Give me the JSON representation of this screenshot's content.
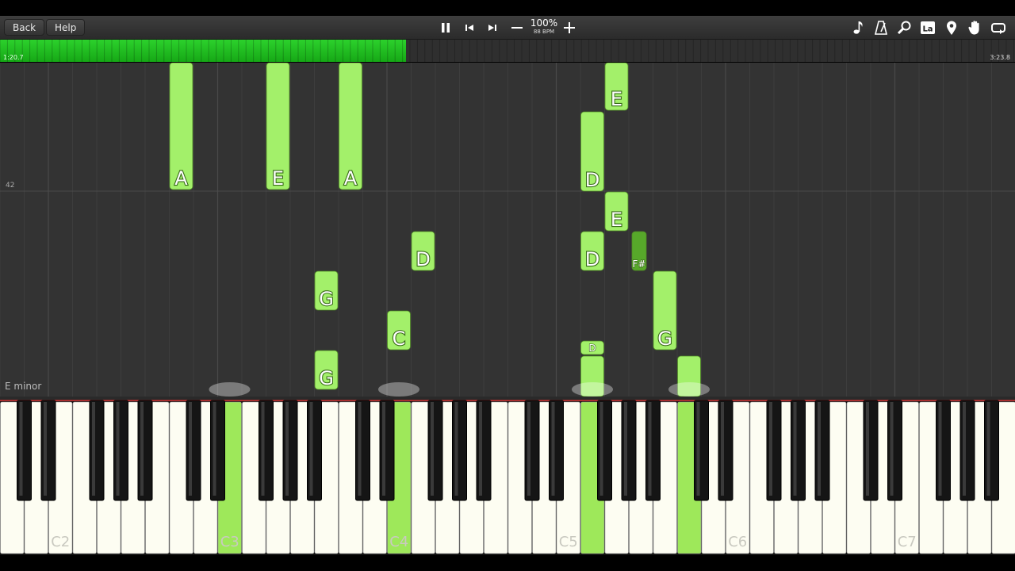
{
  "toolbar": {
    "back_label": "Back",
    "help_label": "Help",
    "speed_percent": "100%",
    "speed_bpm": "88 BPM",
    "icons": [
      "pause-icon",
      "skip-back-icon",
      "skip-forward-icon",
      "minus-icon",
      "plus-icon",
      "note-icon",
      "metronome-icon",
      "magnifier-icon",
      "label-icon",
      "location-pin-icon",
      "hand-icon",
      "loop-icon"
    ],
    "label_icon_text": "La"
  },
  "progress": {
    "current_time": "1:20.7",
    "total_time": "3:23.8",
    "fraction": 0.4
  },
  "roll": {
    "measure_number": "42",
    "key_signature": "E minor",
    "notes": [
      {
        "name": "A",
        "white_index": 7,
        "black": false
      },
      {
        "name": "E",
        "white_index": 11,
        "black": false
      },
      {
        "name": "A",
        "white_index": 14,
        "black": false
      },
      {
        "name": "G",
        "white_index": 13,
        "black": false
      },
      {
        "name": "G",
        "white_index": 13,
        "black": false
      },
      {
        "name": "D",
        "white_index": 17,
        "black": false
      },
      {
        "name": "C",
        "white_index": 16,
        "black": false
      },
      {
        "name": "E",
        "white_index": 25,
        "black": false
      },
      {
        "name": "D",
        "white_index": 24,
        "black": false
      },
      {
        "name": "E",
        "white_index": 25,
        "black": false
      },
      {
        "name": "D",
        "white_index": 24,
        "black": false
      },
      {
        "name": "F#",
        "white_index": 26,
        "black": true
      },
      {
        "name": "G",
        "white_index": 27,
        "black": false
      },
      {
        "name": "D",
        "white_index": 24,
        "black": false
      },
      {
        "name": "",
        "white_index": 24,
        "black": false
      },
      {
        "name": "",
        "white_index": 28,
        "black": false
      }
    ]
  },
  "keyboard": {
    "octave_labels": [
      "C2",
      "C3",
      "C4",
      "C5",
      "C6",
      "C7"
    ],
    "pressed_white_keys": [
      9,
      16,
      24,
      28
    ],
    "active_color": "#9ee85a",
    "note_color": "#a3f06a"
  },
  "colors": {
    "progress_green": "#22c322",
    "roll_background": "#333333",
    "white_key": "#fdfdf2"
  }
}
